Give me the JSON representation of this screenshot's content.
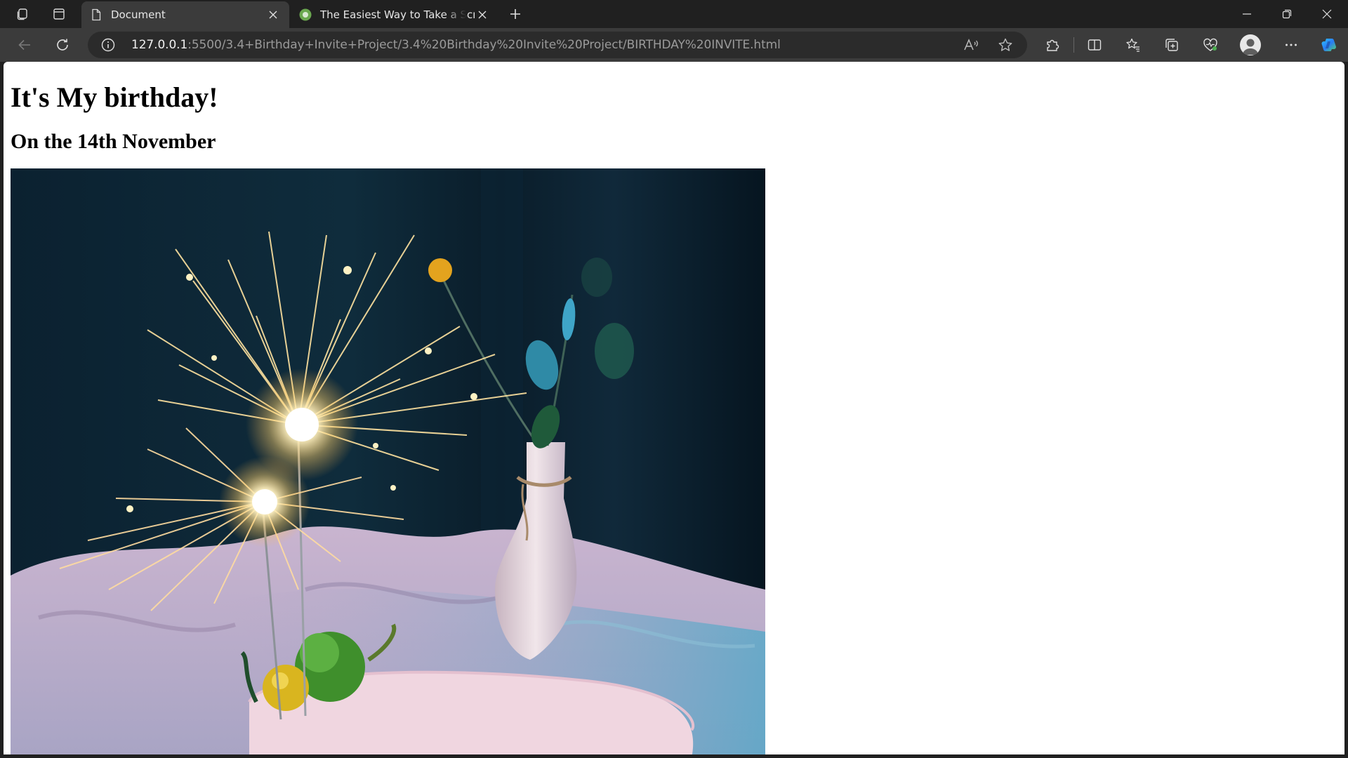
{
  "browser": {
    "tabs": [
      {
        "title": "Document",
        "active": true
      },
      {
        "title": "The Easiest Way to Take a Screenshot",
        "active": false
      }
    ],
    "address_bar": {
      "host": "127.0.0.1",
      "path": ":5500/3.4+Birthday+Invite+Project/3.4%20Birthday%20Invite%20Project/BIRTHDAY%20INVITE.html"
    },
    "colors": {
      "chrome_dark": "#202020",
      "toolbar": "#3b3b3b",
      "omnibox": "#2b2b2b",
      "favicon_green": "#6aa84f"
    }
  },
  "page": {
    "heading": "It's My birthday!",
    "subheading": "On the 14th November",
    "image_alt": "birthday sparklers photo"
  }
}
